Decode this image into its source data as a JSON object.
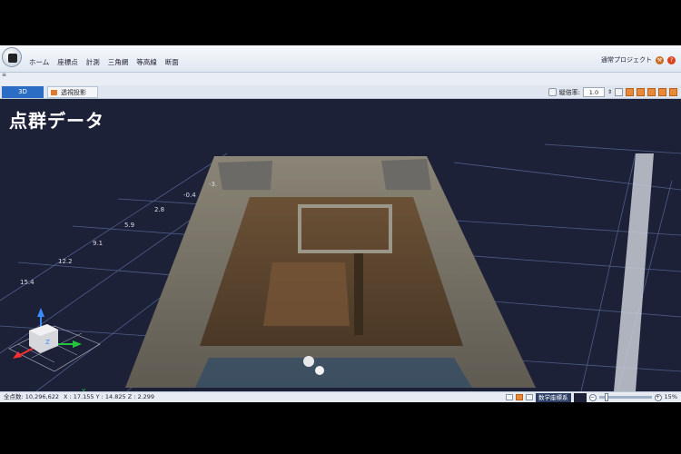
{
  "menubar": {
    "items": [
      "ホーム",
      "座標点",
      "計測",
      "三角網",
      "等高線",
      "断面"
    ],
    "project_label": "通常プロジェクト",
    "quick_access": "≡"
  },
  "tabs": {
    "view_3d": "3D",
    "perspective": "透視投影"
  },
  "toolbar": {
    "exaggeration_label": "縦倍率:",
    "exaggeration_value": "1.0"
  },
  "viewport": {
    "overlay_title": "点群データ",
    "axis_ticks": [
      "-3.",
      "-0.4",
      "2.8",
      "5.9",
      "9.1",
      "12.2",
      "15.4"
    ],
    "axis_labels": {
      "z": "Z",
      "x": "X",
      "y": "Y"
    },
    "background_color": "#1d2138",
    "grid_color": "#5a6c9c"
  },
  "statusbar": {
    "point_count": "全点数: 10,296,622",
    "coordinates": "X : 17.155  Y : 14.825  Z : 2.299",
    "coord_system": "数学座標系",
    "zoom_percent": "15%"
  }
}
